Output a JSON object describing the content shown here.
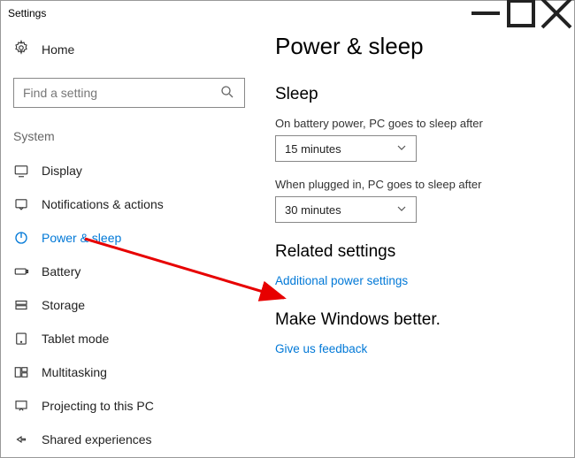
{
  "titlebar": {
    "title": "Settings"
  },
  "home_label": "Home",
  "search": {
    "placeholder": "Find a setting"
  },
  "section_label": "System",
  "nav": [
    {
      "label": "Display"
    },
    {
      "label": "Notifications & actions"
    },
    {
      "label": "Power & sleep"
    },
    {
      "label": "Battery"
    },
    {
      "label": "Storage"
    },
    {
      "label": "Tablet mode"
    },
    {
      "label": "Multitasking"
    },
    {
      "label": "Projecting to this PC"
    },
    {
      "label": "Shared experiences"
    }
  ],
  "content": {
    "heading": "Power & sleep",
    "sleep_heading": "Sleep",
    "battery_label": "On battery power, PC goes to sleep after",
    "battery_value": "15 minutes",
    "plugged_label": "When plugged in, PC goes to sleep after",
    "plugged_value": "30 minutes",
    "related_heading": "Related settings",
    "related_link": "Additional power settings",
    "feedback_heading": "Make Windows better.",
    "feedback_link": "Give us feedback"
  }
}
